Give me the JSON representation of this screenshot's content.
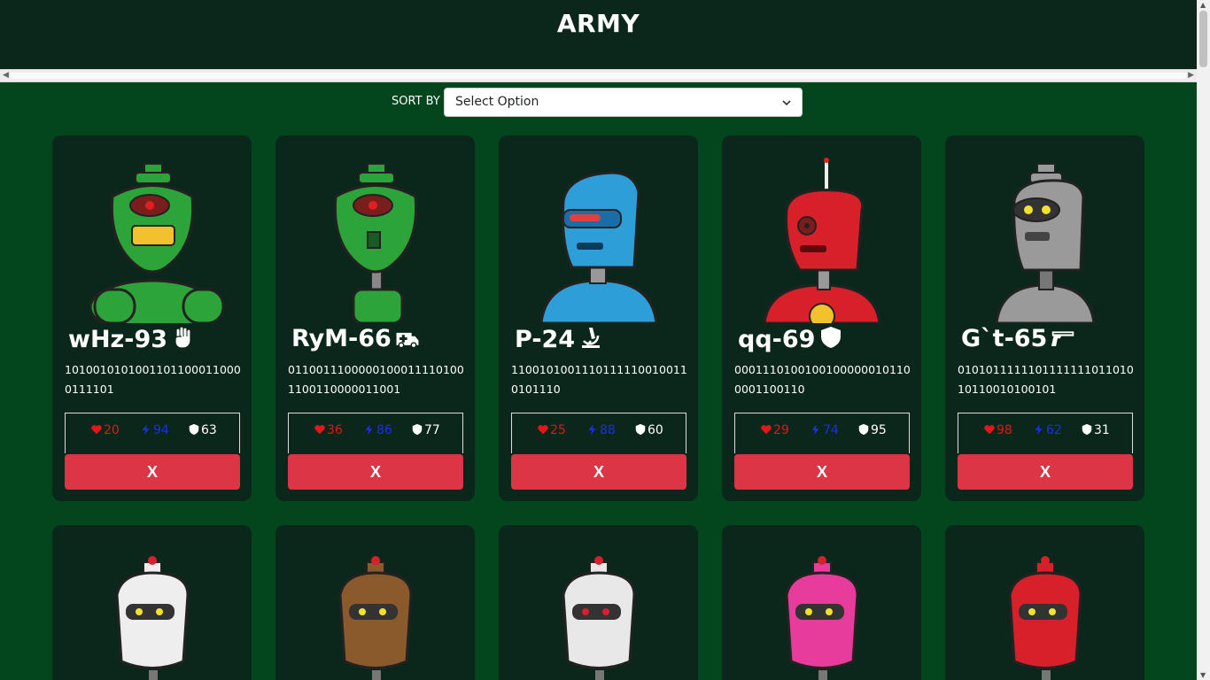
{
  "header": {
    "title": "ARMY"
  },
  "sort": {
    "label": "SORT BY",
    "selected": "Select Option"
  },
  "bots": [
    {
      "name": "wHz-93",
      "class_icon": "fist-icon",
      "catchphrase": "10100101010011011000110000111101",
      "health": "20",
      "damage": "94",
      "armor": "63",
      "remove_label": "X",
      "color": "#2da43a"
    },
    {
      "name": "RyM-66",
      "class_icon": "ambulance-icon",
      "catchphrase": "01100111000001000111101001100110000011001",
      "health": "36",
      "damage": "86",
      "armor": "77",
      "remove_label": "X",
      "color": "#2da43a"
    },
    {
      "name": "P-24",
      "class_icon": "microscope-icon",
      "catchphrase": "11001010011101111100100110101110",
      "health": "25",
      "damage": "88",
      "armor": "60",
      "remove_label": "X",
      "color": "#2d9ed8"
    },
    {
      "name": "qq-69",
      "class_icon": "shield-icon",
      "catchphrase": "00011101001001000000101100001100110",
      "health": "29",
      "damage": "74",
      "armor": "95",
      "remove_label": "X",
      "color": "#d8202a"
    },
    {
      "name": "G`t-65",
      "class_icon": "gun-icon",
      "catchphrase": "010101111110111111101101010110010100101",
      "health": "98",
      "damage": "62",
      "armor": "31",
      "remove_label": "X",
      "color": "#9a9a9a"
    }
  ],
  "bots_row2_colors": [
    "#eeeeee",
    "#8a5a2c",
    "#e8e8e8",
    "#e83c9c",
    "#d8202a"
  ],
  "colors": {
    "health": "#e01818",
    "damage": "#1b2ef0",
    "armor": "#ffffff",
    "remove": "#dc3545"
  }
}
